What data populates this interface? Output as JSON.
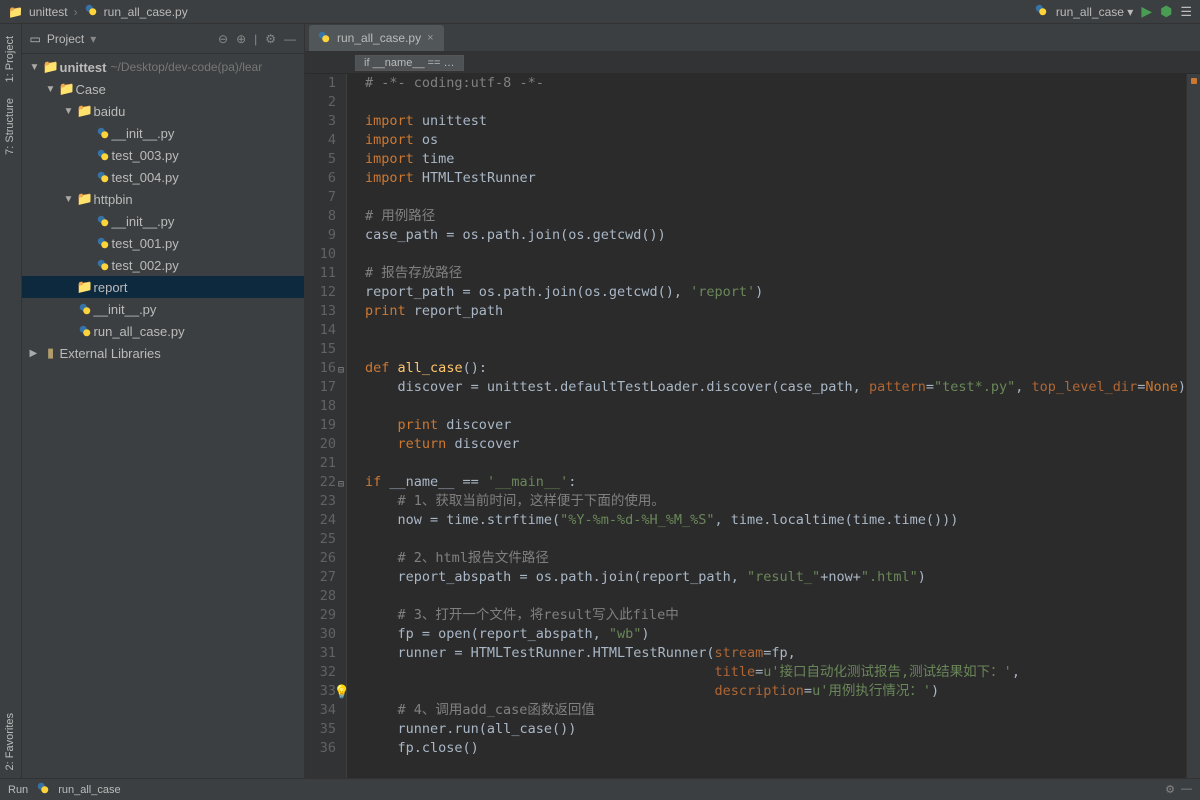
{
  "breadcrumb": {
    "project": "unittest",
    "file": "run_all_case.py"
  },
  "run_config": "run_all_case",
  "panel": {
    "title": "Project"
  },
  "tree": {
    "root": "unittest",
    "root_path": "~/Desktop/dev-code(pa)/lear",
    "case": "Case",
    "baidu": "baidu",
    "init": "__init__.py",
    "test003": "test_003.py",
    "test004": "test_004.py",
    "httpbin": "httpbin",
    "test001": "test_001.py",
    "test002": "test_002.py",
    "report": "report",
    "run_all": "run_all_case.py",
    "ext_lib": "External Libraries"
  },
  "editor_tab": "run_all_case.py",
  "nav_crumb": "if __name__ == …",
  "code_lines": [
    {
      "n": 1,
      "html": "<span class='com'># -*- coding:utf-8 -*-</span>"
    },
    {
      "n": 2,
      "html": ""
    },
    {
      "n": 3,
      "html": "<span class='kw'>import</span> unittest"
    },
    {
      "n": 4,
      "html": "<span class='kw'>import</span> os"
    },
    {
      "n": 5,
      "html": "<span class='kw'>import</span> time"
    },
    {
      "n": 6,
      "html": "<span class='kw'>import</span> HTMLTestRunner"
    },
    {
      "n": 7,
      "html": ""
    },
    {
      "n": 8,
      "html": "<span class='com'># 用例路径</span>"
    },
    {
      "n": 9,
      "html": "case_path = os.path.join(os.getcwd())"
    },
    {
      "n": 10,
      "html": ""
    },
    {
      "n": 11,
      "html": "<span class='com'># 报告存放路径</span>"
    },
    {
      "n": 12,
      "html": "report_path = os.path.join(os.getcwd(), <span class='str'>'report'</span>)"
    },
    {
      "n": 13,
      "html": "<span class='kw'>print</span> report_path"
    },
    {
      "n": 14,
      "html": ""
    },
    {
      "n": 15,
      "html": ""
    },
    {
      "n": 16,
      "fold": true,
      "html": "<span class='kw'>def</span> <span class='fn'>all_case</span>():"
    },
    {
      "n": 17,
      "html": "    discover = unittest.defaultTestLoader.discover(case_path, <span class='arg'>pattern</span>=<span class='str'>\"test*.py\"</span>, <span class='arg'>top_level_dir</span>=<span class='kw'>None</span>)"
    },
    {
      "n": 18,
      "html": ""
    },
    {
      "n": 19,
      "html": "    <span class='kw'>print</span> discover"
    },
    {
      "n": 20,
      "html": "    <span class='kw'>return</span> discover"
    },
    {
      "n": 21,
      "html": ""
    },
    {
      "n": 22,
      "fold": true,
      "html": "<span class='kw'>if</span> __name__ == <span class='str'>'__main__'</span>:"
    },
    {
      "n": 23,
      "html": "    <span class='com'># 1、获取当前时间，这样便于下面的使用。</span>"
    },
    {
      "n": 24,
      "html": "    now = time.strftime(<span class='str'>\"%Y-%m-%d-%H_%M_%S\"</span>, time.localtime(time.time()))"
    },
    {
      "n": 25,
      "html": ""
    },
    {
      "n": 26,
      "html": "    <span class='com'># 2、html报告文件路径</span>"
    },
    {
      "n": 27,
      "html": "    report_abspath = os.path.join(report_path, <span class='str'>\"result_\"</span>+now+<span class='str'>\".html\"</span>)"
    },
    {
      "n": 28,
      "html": ""
    },
    {
      "n": 29,
      "html": "    <span class='com'># 3、打开一个文件，将result写入此file中</span>"
    },
    {
      "n": 30,
      "html": "    fp = open(report_abspath, <span class='str'>\"wb\"</span>)"
    },
    {
      "n": 31,
      "html": "    runner = HTMLTestRunner.HTMLTestRunner(<span class='arg'>stream</span>=fp,"
    },
    {
      "n": 32,
      "html": "                                           <span class='arg'>title</span>=<span class='str'>u'接口自动化测试报告,测试结果如下：'</span>,"
    },
    {
      "n": 33,
      "bulb": true,
      "html": "                                           <span class='arg'>description</span>=<span class='str'>u'用例执行情况：'</span>)"
    },
    {
      "n": 34,
      "html": "    <span class='com'># 4、调用add_case函数返回值</span>"
    },
    {
      "n": 35,
      "html": "    runner.run(all_case())"
    },
    {
      "n": 36,
      "html": "    fp.close()"
    }
  ],
  "side_tabs": {
    "project": "1: Project",
    "structure": "7: Structure",
    "favorites": "2: Favorites"
  },
  "bottom": {
    "run": "Run",
    "run_target": "run_all_case"
  }
}
